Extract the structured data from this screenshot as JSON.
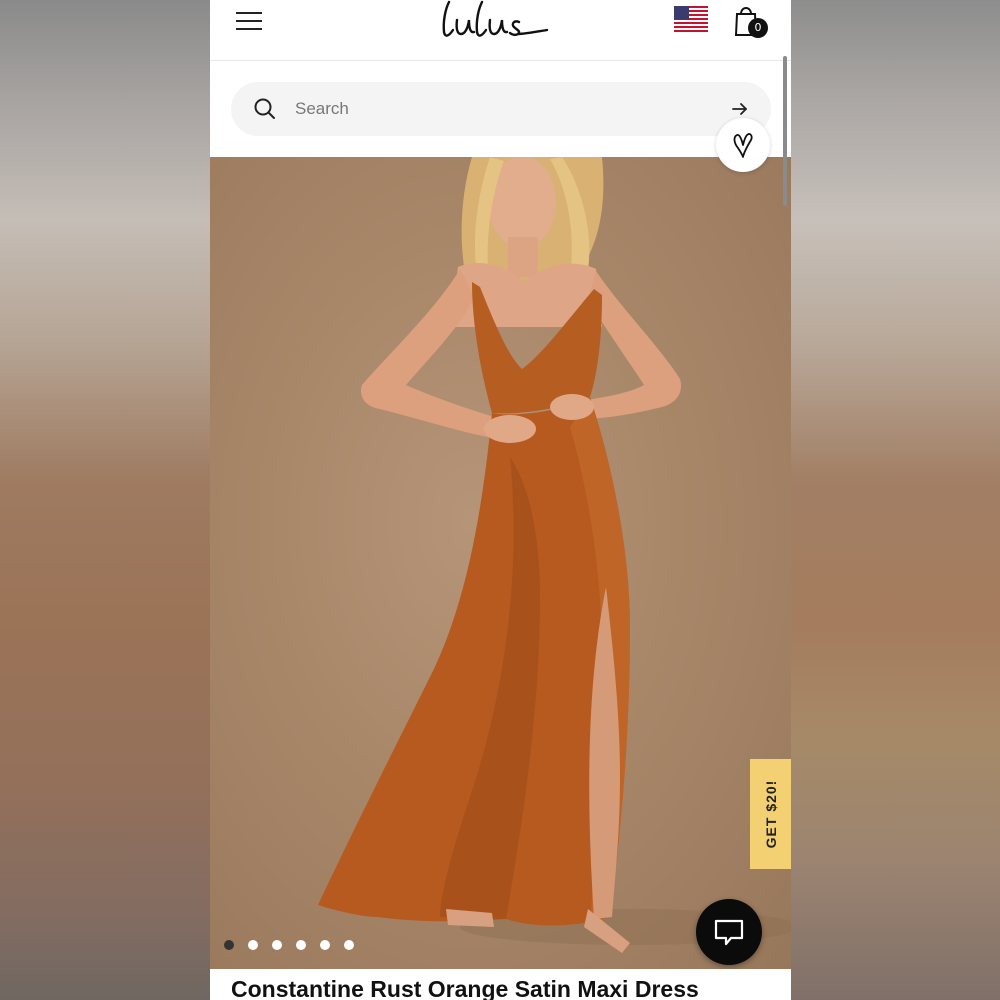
{
  "header": {
    "logo_text": "Lulus",
    "bag_count": "0"
  },
  "search": {
    "placeholder": "Search"
  },
  "carousel": {
    "total_slides": 6,
    "active_slide": 1
  },
  "promo": {
    "label": "GET $20!"
  },
  "product": {
    "title": "Constantine Rust Orange Satin Maxi Dress"
  },
  "colors": {
    "promo_bg": "#f3d173",
    "dress": "#b45a1e",
    "backdrop": "#a88769",
    "chat_button": "#0b0b0b"
  },
  "icons": {
    "menu": "hamburger-icon",
    "flag": "us-flag-icon",
    "bag": "shopping-bag-icon",
    "search": "search-icon",
    "search_go": "arrow-right-icon",
    "wishlist": "heart-icon",
    "chat": "chat-bubble-icon"
  }
}
